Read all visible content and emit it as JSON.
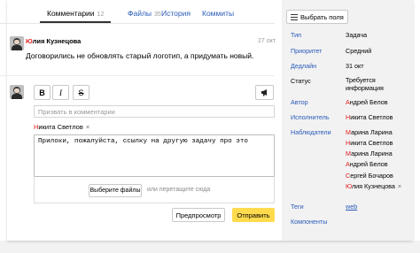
{
  "tabs": [
    {
      "label": "Комментарии",
      "count": "12"
    },
    {
      "label": "Файлы",
      "count": "35"
    },
    {
      "label": "История",
      "count": ""
    },
    {
      "label": "Коммиты",
      "count": ""
    }
  ],
  "comment": {
    "author_first_letter": "Ю",
    "author_rest": "лия Кузнецова",
    "date": "27 окт",
    "text": "Договорились не обновлять старый логотип, а придумать новый."
  },
  "editor": {
    "bold": "B",
    "italic": "I",
    "strike": "S",
    "mention_placeholder": "Призвать в комментарии",
    "chip_first_letter": "Н",
    "chip_rest": "икита Светлов",
    "chip_close": "×",
    "text": "Прилоки, пожалуйста, ссылку на другую задачу про это",
    "choose_files_label": "Выберите файлы",
    "drag_hint": "или перетащите сюда",
    "preview_label": "Предпросмотр",
    "send_label": "Отправить"
  },
  "panel": {
    "select_fields_label": "Выбрать поля",
    "fields": {
      "type": {
        "label": "Тип",
        "value": "Задача"
      },
      "priority": {
        "label": "Приоритет",
        "value": "Средний"
      },
      "deadline": {
        "label": "Дедлайн",
        "value": "31 окт"
      },
      "status": {
        "label": "Статус",
        "value_line1": "Требуется",
        "value_line2": "информация"
      },
      "author": {
        "label": "Автор",
        "first": "А",
        "rest": "ндрей Белов"
      },
      "assignee": {
        "label": "Исполнитель",
        "first": "Н",
        "rest": "икита Светлов"
      },
      "watchers": {
        "label": "Наблюдатели",
        "people": [
          {
            "first": "М",
            "rest": "арина Ларина"
          },
          {
            "first": "Н",
            "rest": "икита Светлов"
          },
          {
            "first": "М",
            "rest": "арина Ларина"
          },
          {
            "first": "А",
            "rest": "ндрей Белов"
          },
          {
            "first": "С",
            "rest": "ергей Бочаров"
          },
          {
            "first": "Ю",
            "rest": "лия Кузнецова"
          }
        ]
      },
      "tags": {
        "label": "Теги",
        "value": "web"
      },
      "components": {
        "label": "Компоненты"
      }
    },
    "remove_symbol": "×"
  },
  "colors": {
    "link": "#2a5bb8",
    "accent_letter": "#e02020",
    "send_button": "#ffdb4d",
    "panel_bg": "#f2f2f2"
  },
  "icons": [
    "avatar-yulia",
    "bold-icon",
    "italic-icon",
    "strike-icon",
    "megaphone-icon",
    "list-settings-icon",
    "close-icon"
  ]
}
